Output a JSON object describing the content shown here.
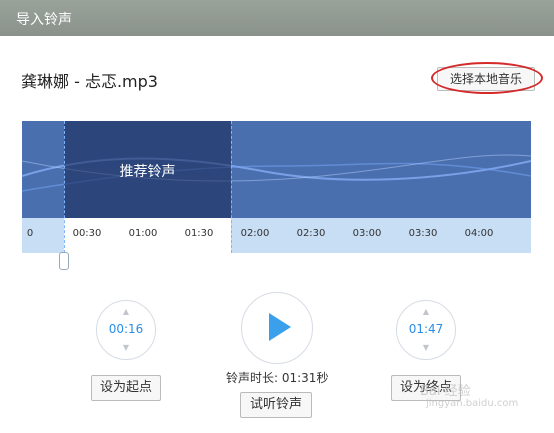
{
  "window": {
    "title": "导入铃声"
  },
  "song": {
    "title": "龚琳娜 - 忐忑.mp3"
  },
  "select_button": {
    "label": "选择本地音乐"
  },
  "waveform": {
    "recommended_label": "推荐铃声",
    "ticks": [
      "0",
      "00:30",
      "01:00",
      "01:30",
      "02:00",
      "02:30",
      "03:00",
      "03:30",
      "04:00"
    ]
  },
  "start": {
    "time": "00:16",
    "button": "设为起点"
  },
  "end": {
    "time": "01:47",
    "button": "设为终点"
  },
  "duration_text": "铃声时长: 01:31秒",
  "listen_button": "试听铃声",
  "watermark": {
    "line1": "Bai 经验",
    "line2": "jingyan.baidu.com"
  },
  "colors": {
    "accent": "#2a8de6",
    "highlight": "#d42a2a",
    "wave_bg": "#4a6fae"
  }
}
